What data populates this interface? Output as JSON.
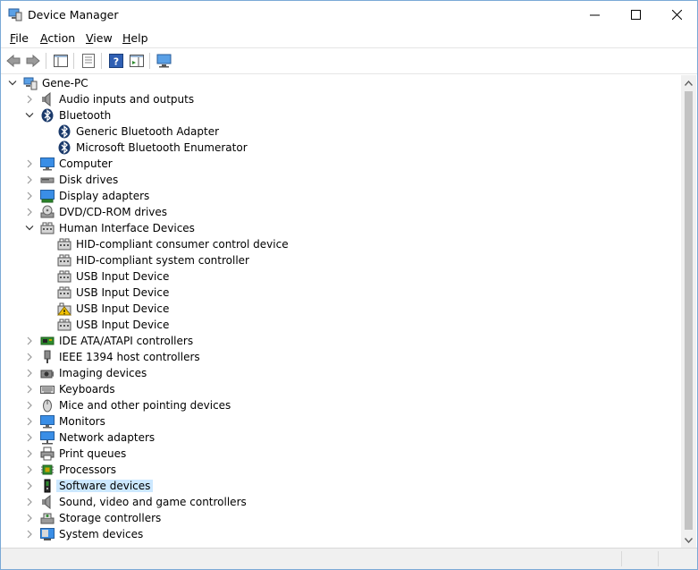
{
  "window": {
    "title": "Device Manager"
  },
  "menu": [
    {
      "label": "File",
      "underline": "F",
      "rest": "ile"
    },
    {
      "label": "Action",
      "underline": "A",
      "rest": "ction"
    },
    {
      "label": "View",
      "underline": "V",
      "rest": "iew"
    },
    {
      "label": "Help",
      "underline": "H",
      "rest": "elp"
    }
  ],
  "tree": {
    "root": "Gene-PC",
    "items": [
      {
        "label": "Audio inputs and outputs",
        "icon": "speaker-icon",
        "expanded": false
      },
      {
        "label": "Bluetooth",
        "icon": "bluetooth-icon",
        "expanded": true,
        "children": [
          {
            "label": "Generic Bluetooth Adapter",
            "icon": "bluetooth-icon"
          },
          {
            "label": "Microsoft Bluetooth Enumerator",
            "icon": "bluetooth-icon"
          }
        ]
      },
      {
        "label": "Computer",
        "icon": "monitor-icon",
        "expanded": false
      },
      {
        "label": "Disk drives",
        "icon": "disk-drive-icon",
        "expanded": false
      },
      {
        "label": "Display adapters",
        "icon": "display-adapter-icon",
        "expanded": false
      },
      {
        "label": "DVD/CD-ROM drives",
        "icon": "dvd-icon",
        "expanded": false
      },
      {
        "label": "Human Interface Devices",
        "icon": "hid-icon",
        "expanded": true,
        "children": [
          {
            "label": "HID-compliant consumer control device",
            "icon": "hid-icon"
          },
          {
            "label": "HID-compliant system controller",
            "icon": "hid-icon"
          },
          {
            "label": "USB Input Device",
            "icon": "hid-icon"
          },
          {
            "label": "USB Input Device",
            "icon": "hid-icon"
          },
          {
            "label": "USB Input Device",
            "icon": "hid-warning-icon"
          },
          {
            "label": "USB Input Device",
            "icon": "hid-icon"
          }
        ]
      },
      {
        "label": "IDE ATA/ATAPI controllers",
        "icon": "ide-controller-icon",
        "expanded": false
      },
      {
        "label": "IEEE 1394 host controllers",
        "icon": "ieee1394-icon",
        "expanded": false
      },
      {
        "label": "Imaging devices",
        "icon": "camera-icon",
        "expanded": false
      },
      {
        "label": "Keyboards",
        "icon": "keyboard-icon",
        "expanded": false
      },
      {
        "label": "Mice and other pointing devices",
        "icon": "mouse-icon",
        "expanded": false
      },
      {
        "label": "Monitors",
        "icon": "monitor-icon",
        "expanded": false
      },
      {
        "label": "Network adapters",
        "icon": "network-icon",
        "expanded": false
      },
      {
        "label": "Print queues",
        "icon": "printer-icon",
        "expanded": false
      },
      {
        "label": "Processors",
        "icon": "processor-icon",
        "expanded": false
      },
      {
        "label": "Software devices",
        "icon": "software-device-icon",
        "expanded": false,
        "selected": true
      },
      {
        "label": "Sound, video and game controllers",
        "icon": "speaker-icon",
        "expanded": false
      },
      {
        "label": "Storage controllers",
        "icon": "storage-controller-icon",
        "expanded": false
      },
      {
        "label": "System devices",
        "icon": "system-devices-icon",
        "expanded": false
      }
    ]
  },
  "colors": {
    "selection": "#cce8ff",
    "accent": "#1e6fd9"
  }
}
